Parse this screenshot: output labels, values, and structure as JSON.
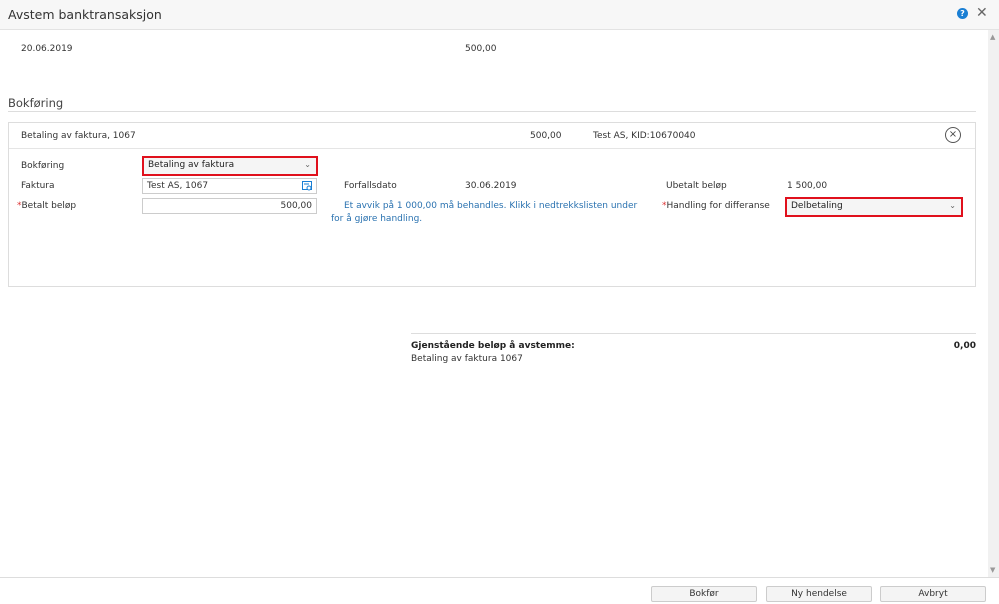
{
  "colors": {
    "accent": "#1a7fd4",
    "highlight": "#e0101c"
  },
  "dialog": {
    "title": "Avstem banktransaksjon",
    "help_icon": "question-circle-icon",
    "close_icon": "close-icon"
  },
  "transaction": {
    "date": "20.06.2019",
    "amount": "500,00"
  },
  "section_title": "Bokføring",
  "entry": {
    "header": {
      "label": "Betaling av faktura, 1067",
      "amount": "500,00",
      "reference": "Test AS, KID:10670040"
    },
    "bokforing_label": "Bokføring",
    "bokforing_value": "Betaling av faktura",
    "faktura_label": "Faktura",
    "faktura_value": "Test AS, 1067",
    "betalt_label": "Betalt beløp",
    "betalt_value": "500,00",
    "forfall_label": "Forfallsdato",
    "forfall_value": "30.06.2019",
    "ubetalt_label": "Ubetalt beløp",
    "ubetalt_value": "1 500,00",
    "message": "Et avvik på 1 000,00 må behandles. Klikk i nedtrekkslisten under for å gjøre handling.",
    "handling_label": "Handling for differanse",
    "handling_value": "Delbetaling",
    "required_mark": "*"
  },
  "summary": {
    "label": "Gjenstående beløp å avstemme:",
    "value": "0,00",
    "detail": "Betaling av faktura 1067"
  },
  "footer": {
    "bokfor": "Bokfør",
    "ny": "Ny hendelse",
    "avbryt": "Avbryt"
  }
}
